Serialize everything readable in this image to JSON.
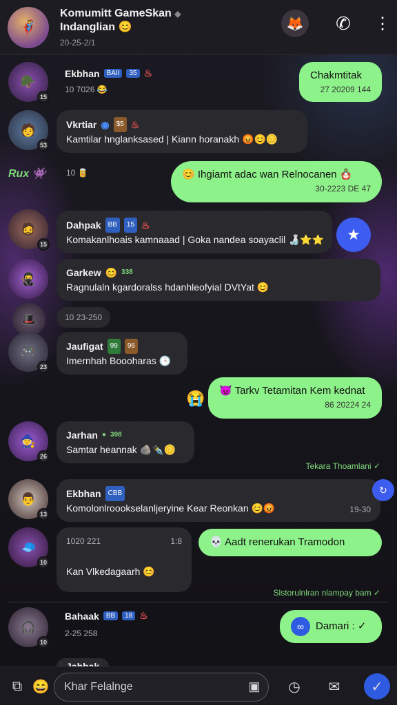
{
  "header": {
    "title": "Komumitt GameSkan",
    "subtitle": "Indanglian 😊",
    "date": "20-25-2/1"
  },
  "messages": [
    {
      "name": "Ekbhan",
      "tags": [
        "BAII",
        "35"
      ],
      "time": "10 7026",
      "text": "😂",
      "num": "15"
    },
    {
      "out": "Chakmtitak",
      "out_time": "27 20209 144"
    },
    {
      "name": "Vkrtiar",
      "tags": [
        "$5"
      ],
      "text": "Kamtilar hnglanksased | Kiann horanakh 😡😊🪙",
      "num": "53"
    },
    {
      "out": "😊 Ihgiamt adac wan Relnocanen 🪆",
      "out_time": "30-2223 DE 47",
      "side_label": "Rux",
      "in_time": "10"
    },
    {
      "name": "Dahpak",
      "tags": [
        "BB",
        "15"
      ],
      "text": "Komakanlhoais kamnaaad | Goka nandea soayaclil 🍶⭐⭐",
      "num": "15"
    },
    {
      "name": "Garkew",
      "text": "Ragnulaln kgardoralss hdanhleofyial DVtYat 😊",
      "tags": [
        "338"
      ]
    },
    {
      "in_time": "10 23-250"
    },
    {
      "name": "Jaufigat",
      "tags": [
        "99",
        "96"
      ],
      "text": "Imernhah Boooharas 🕒",
      "num": "23"
    },
    {
      "out": "😈 Tarkv Tetamitan Kem kednat",
      "out_time": "86 20224 24"
    },
    {
      "name": "Jarhan",
      "tags": [
        "398"
      ],
      "text": "Samtar heannak 🪨✒️🪙",
      "num": "26"
    },
    {
      "status": "Tekara Thoamlani ✓"
    },
    {
      "name": "Ekbhan",
      "tags": [
        "CBB"
      ],
      "text": "Komolonlroookselanljeryine Kear Reonkan 😊😡",
      "time": "19-30",
      "num": "13"
    },
    {
      "in_time": "1020 221",
      "in_time2": "1:8",
      "out": "💀 Aadt renerukan Tramodon",
      "text": "Kan Vlkedagaarh 😊",
      "num": "10"
    },
    {
      "status": "Slstorulnlran nlampay bam ✓"
    },
    {
      "name": "Bahaak",
      "tags": [
        "BB",
        "18"
      ],
      "time": "2-25 258",
      "out": "Damari : ✓",
      "num": "10"
    },
    {
      "name": "Jahbak"
    }
  ],
  "composer": {
    "placeholder": "Khar Felalnge"
  },
  "colors": {
    "out_bubble": "#8ef28a",
    "in_bubble": "#2a292e",
    "accent": "#2f5be0"
  }
}
